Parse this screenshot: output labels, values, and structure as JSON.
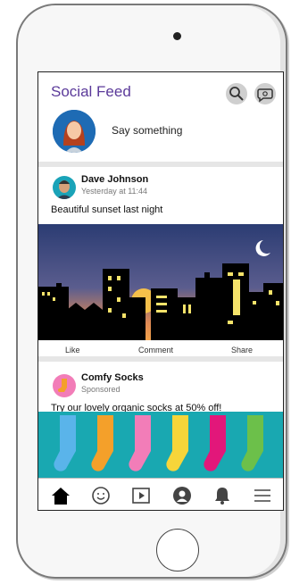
{
  "header": {
    "title": "Social Feed",
    "composer_placeholder": "Say something"
  },
  "posts": [
    {
      "author": "Dave Johnson",
      "meta": "Yesterday at 11:44",
      "text": "Beautiful sunset last night",
      "actions": [
        "Like",
        "Comment",
        "Share"
      ]
    },
    {
      "author": "Comfy Socks",
      "meta": "Sponsored",
      "text": "Try our lovely organic socks at 50% off!"
    }
  ],
  "colors": {
    "title": "#5b3a9a",
    "ad_bg": "#19a8b1"
  },
  "icons": {
    "search": "search-icon",
    "chat": "chat-icon",
    "home": "home-icon",
    "emoji": "smiley-icon",
    "video": "video-icon",
    "profile": "profile-icon",
    "notifications": "bell-icon",
    "menu": "menu-icon"
  }
}
